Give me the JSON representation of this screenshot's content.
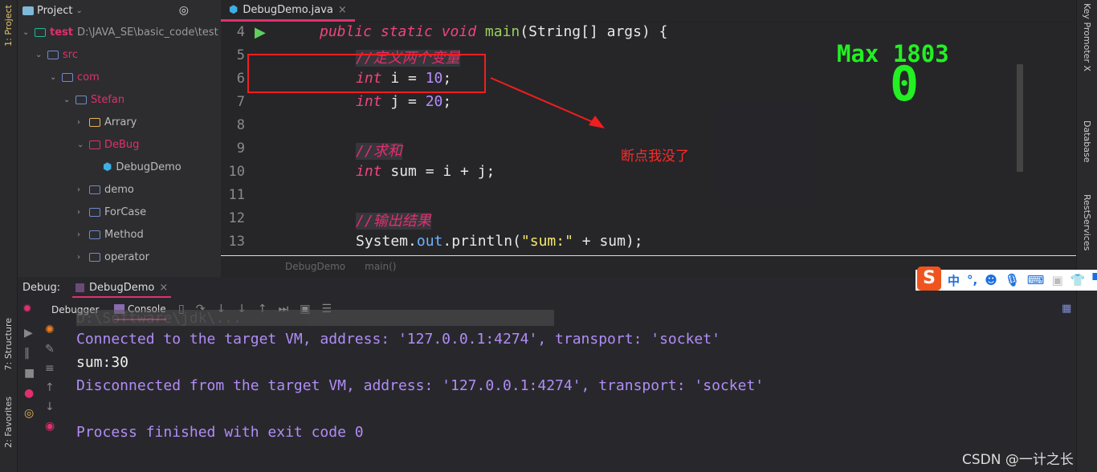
{
  "left_stripe": {
    "project": "1: Project",
    "structure": "7: Structure",
    "favorites": "2: Favorites"
  },
  "right_stripe": {
    "key_promoter": "Key Promoter X",
    "database": "Database",
    "rest": "RestServices"
  },
  "project": {
    "title": "Project",
    "root_name": "test",
    "root_path": "D:\\JAVA_SE\\basic_code\\test",
    "items": [
      "src",
      "com",
      "Stefan",
      "Arrary",
      "DeBug",
      "DebugDemo",
      "demo",
      "ForCase",
      "Method",
      "operator"
    ]
  },
  "editor": {
    "tab": "DebugDemo.java",
    "line_numbers": [
      "4",
      "5",
      "6",
      "7",
      "8",
      "9",
      "10",
      "11",
      "12",
      "13"
    ],
    "breadcrumb": [
      "DebugDemo",
      "main()"
    ],
    "code": {
      "l4_kw": "public static void ",
      "l4_fn": "main",
      "l4_rest": "(String[] args) {",
      "c5": "//定义两个变量",
      "l6_kw": "int",
      "l6_a": " i = ",
      "l6_n": "10",
      "l6_e": ";",
      "l7_kw": "int",
      "l7_a": " j = ",
      "l7_n": "20",
      "l7_e": ";",
      "c9": "//求和",
      "l10_kw": "int",
      "l10_a": " sum = i + j;",
      "c12": "//输出结果",
      "l13_a": "System.",
      "l13_f": "out",
      "l13_b": ".println(",
      "l13_s": "\"sum:\"",
      "l13_c": " + sum);"
    },
    "annotation": "断点我没了",
    "overlay": {
      "max": "Max 1803",
      "score": "0"
    },
    "annotation_color": "#ff2a2a"
  },
  "debug": {
    "label": "Debug:",
    "tab": "DebugDemo",
    "subtabs": [
      "Debugger",
      "Console"
    ],
    "console": [
      "D:\\Software\\jdk\\...",
      "Connected to the target VM, address: '127.0.0.1:4274', transport: 'socket'",
      "sum:30",
      "Disconnected from the target VM, address: '127.0.0.1:4274', transport: 'socket'",
      "",
      "Process finished with exit code 0"
    ]
  },
  "ime": {
    "lang": "中",
    "punct": "°,"
  },
  "watermark": "CSDN @一计之长"
}
